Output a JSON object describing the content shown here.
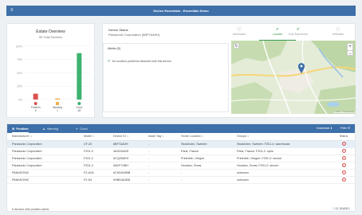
{
  "header": {
    "title": "Device Essentials - Essentials Demo"
  },
  "overview": {
    "title": "Estate Overview",
    "subtitle": "55 Total Devices",
    "y_ticks": [
      "100%",
      "75%",
      "50%",
      "25%",
      "0%"
    ],
    "bars": [
      {
        "label": "Problem",
        "count": "6",
        "pct": 11,
        "color": "#d9534f",
        "icon": "error-icon"
      },
      {
        "label": "Warning",
        "count": "1",
        "pct": 2,
        "color": "#f0ad4e",
        "icon": "warning-icon"
      },
      {
        "label": "Good",
        "count": "48",
        "pct": 87,
        "color": "#3cb371",
        "icon": "check-icon"
      }
    ]
  },
  "status": {
    "label": "Device Status",
    "device": "Panasonic Corporation (6BFTAA0H)",
    "tabs": [
      {
        "label": "Information",
        "icon": "info-icon"
      },
      {
        "label": "Location",
        "icon": "check-icon"
      },
      {
        "label": "User Experience",
        "icon": "check-icon"
      },
      {
        "label": "Utilization",
        "icon": "info-icon"
      }
    ],
    "alerts_heading": "Alerts (0)",
    "alerts_message": "No location problems detected with this device"
  },
  "map": {
    "attribution": "Leaflet | © OpenStreetMap"
  },
  "table": {
    "tabs": {
      "problem": "Problem",
      "warning": "Warning",
      "good": "Good"
    },
    "download_label": "Download",
    "filter_label": "Filter",
    "columns": [
      "Manufacturer",
      "Model",
      "Device ID",
      "Asset Tag",
      "Home Location",
      "Groups",
      "Status"
    ],
    "rows": [
      {
        "manufacturer": "Panasonic Corporation",
        "model": "CF-20",
        "device_id": "6BFTAA0H",
        "asset_tag": "-",
        "location": "Stockholm, Sweden",
        "groups": "Stockholm, Sweden: FZ01-4: warehouse"
      },
      {
        "manufacturer": "Panasonic Corporation",
        "model": "FZ01-2",
        "device_id": "3AGD0A0H",
        "asset_tag": "-",
        "location": "Paris, France",
        "groups": "Paris, France: FZ01-2: open"
      },
      {
        "manufacturer": "Panasonic Corporation",
        "model": "FZ01-2",
        "device_id": "5CQ20AEH",
        "asset_tag": "-",
        "location": "Prineville, Oregon",
        "groups": "Prineville, Oregon: FZ01-2: secure"
      },
      {
        "manufacturer": "Panasonic Corporation",
        "model": "FZ01-2",
        "device_id": "9AEFY0BH",
        "asset_tag": "-",
        "location": "Houston, Texas",
        "groups": "Houston, Texas: FZ01-2: secure"
      },
      {
        "manufacturer": "PANASONIC",
        "model": "FZ-A2A",
        "device_id": "6CK0A0HBB",
        "asset_tag": "-",
        "location": "-",
        "groups": "unknown"
      },
      {
        "manufacturer": "PANASONIC",
        "model": "FZ-N1",
        "device_id": "5HBD4A1B8",
        "asset_tag": "-",
        "location": "-",
        "groups": "unknown"
      }
    ],
    "footer": "6 devices with problem alerts",
    "pager": "1 - 6 of 6"
  }
}
